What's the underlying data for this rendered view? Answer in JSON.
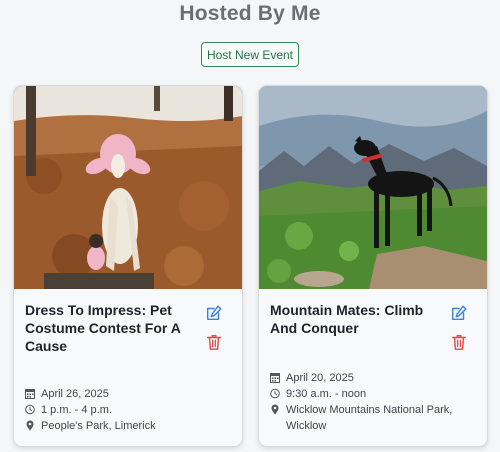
{
  "page": {
    "title": "Hosted By Me"
  },
  "actions": {
    "host_new_event": "Host New Event"
  },
  "events": [
    {
      "title": "Dress To Impress: Pet Costume Contest For A Cause",
      "date": "April 26, 2025",
      "time": "1 p.m. - 4 p.m.",
      "location": "People's Park, Limerick",
      "image": "dog-in-pink-costume-autumn-leaves"
    },
    {
      "title": "Mountain Mates: Climb And Conquer",
      "date": "April 20, 2025",
      "time": "9:30 a.m. - noon",
      "location": "Wicklow Mountains National Park, Wicklow",
      "image": "black-dog-on-mountain-rock"
    }
  ],
  "icons": {
    "edit": "edit-icon",
    "delete": "trash-icon",
    "date": "calendar-icon",
    "time": "clock-icon",
    "location": "map-pin-icon"
  },
  "colors": {
    "primary_green": "#2e8b57",
    "edit_blue": "#3b82d6",
    "delete_red": "#e0484b"
  }
}
